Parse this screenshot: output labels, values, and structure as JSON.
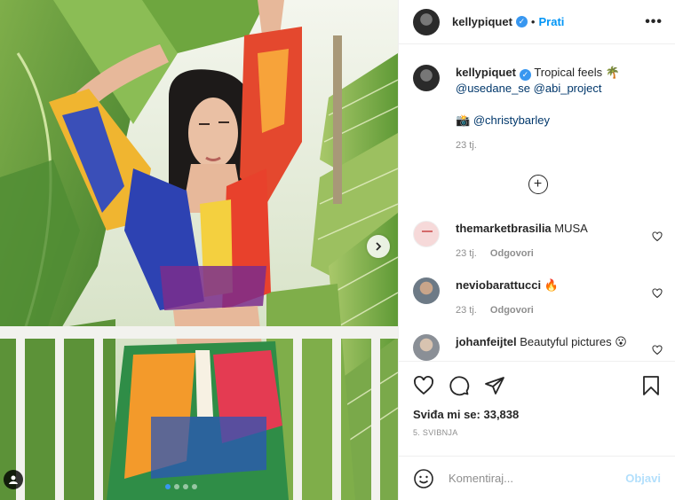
{
  "post": {
    "username": "kellypiquet",
    "follow_label": "Prati",
    "dot_separator": "•",
    "more_icon": "more-horizontal-icon",
    "verified_icon": "verified-badge-icon"
  },
  "caption": {
    "username": "kellypiquet",
    "text": "Tropical feels 🌴",
    "mention_1": "@usedane_se",
    "mention_2": "@abi_project",
    "camera_emoji": "📸",
    "mention_3": "@christybarley",
    "time": "23 tj."
  },
  "load_more_icon": "plus-circle-icon",
  "comments": [
    {
      "username": "themarketbrasilia",
      "text": "MUSA",
      "time": "23 tj.",
      "reply_label": "Odgovori"
    },
    {
      "username": "neviobarattucci",
      "text": "🔥",
      "time": "23 tj.",
      "reply_label": "Odgovori"
    },
    {
      "username": "johanfeijtel",
      "text": "Beautyful pictures 😮",
      "time": "",
      "reply_label": ""
    }
  ],
  "actions": {
    "like_icon": "heart-icon",
    "comment_icon": "comment-icon",
    "share_icon": "share-icon",
    "save_icon": "bookmark-icon",
    "likes": "Sviđa mi se: 33,838",
    "date": "5. SVIBNJA"
  },
  "add_comment": {
    "emoji_icon": "emoji-icon",
    "placeholder": "Komentiraj...",
    "post_label": "Objavi"
  },
  "media": {
    "next_icon": "chevron-right-icon",
    "tag_icon": "user-tag-icon",
    "carousel_total": 4,
    "carousel_active": 1
  },
  "colors": {
    "link": "#00376b",
    "accent": "#0095f6",
    "post_disabled": "#b2dffc",
    "muted": "#8e8e8e"
  }
}
